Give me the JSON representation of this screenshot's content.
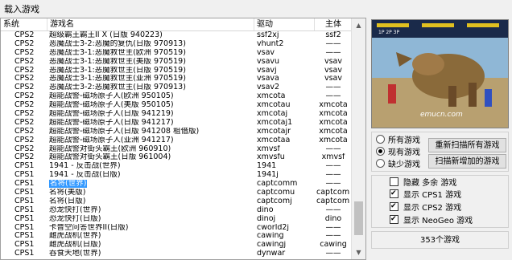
{
  "window": {
    "title": "载入游戏"
  },
  "columns": {
    "system": "系统",
    "name": "游戏名",
    "driver": "驱动",
    "host": "主体"
  },
  "rows": [
    {
      "system": "CPS2",
      "name": "超级霸王霸王II X (日版 940223)",
      "driver": "ssf2xj",
      "host": "ssf2"
    },
    {
      "system": "CPS2",
      "name": "恶魔战士3-2:恶魔的复仇(日版 970913)",
      "driver": "vhunt2",
      "host": "——"
    },
    {
      "system": "CPS2",
      "name": "恶魔战士3-1:恶魔救世主(欧洲 970519)",
      "driver": "vsav",
      "host": "——"
    },
    {
      "system": "CPS2",
      "name": "恶魔战士3-1:恶魔救世主(美版 970519)",
      "driver": "vsavu",
      "host": "vsav"
    },
    {
      "system": "CPS2",
      "name": "恶魔战士3-1:恶魔救世主(日版 970519)",
      "driver": "vsavj",
      "host": "vsav"
    },
    {
      "system": "CPS2",
      "name": "恶魔战士3-1:恶魔救世主(亚洲 970519)",
      "driver": "vsava",
      "host": "vsav"
    },
    {
      "system": "CPS2",
      "name": "恶魔战士3-2:恶魔救世主(日版 970913)",
      "driver": "vsav2",
      "host": "——"
    },
    {
      "system": "CPS2",
      "name": "超能战警-磁场原子人(欧洲 950105)",
      "driver": "xmcota",
      "host": "——"
    },
    {
      "system": "CPS2",
      "name": "超能战警-磁场原子人(美版 950105)",
      "driver": "xmcotau",
      "host": "xmcota"
    },
    {
      "system": "CPS2",
      "name": "超能战警-磁场原子人(日版 941219)",
      "driver": "xmcotaj",
      "host": "xmcota"
    },
    {
      "system": "CPS2",
      "name": "超能战警-磁场原子人(日版 941217)",
      "driver": "xmcotaj1",
      "host": "xmcota"
    },
    {
      "system": "CPS2",
      "name": "超能战警-磁场原子人(日版 941208 租借版)",
      "driver": "xmcotajr",
      "host": "xmcota"
    },
    {
      "system": "CPS2",
      "name": "超能战警-磁场原子人(亚洲 941217)",
      "driver": "xmcotaa",
      "host": "xmcota"
    },
    {
      "system": "CPS2",
      "name": "超能战警对街头霸王(欧洲 960910)",
      "driver": "xmvsf",
      "host": "——"
    },
    {
      "system": "CPS2",
      "name": "超能战警对街头霸王(日版 961004)",
      "driver": "xmvsfu",
      "host": "xmvsf"
    },
    {
      "system": "CPS1",
      "name": "1941 - 反击战(世界)",
      "driver": "1941",
      "host": "——"
    },
    {
      "system": "CPS1",
      "name": "1941 - 反击战(日版)",
      "driver": "1941j",
      "host": "——"
    },
    {
      "system": "CPS1",
      "name": "名将(世界)",
      "driver": "captcomm",
      "host": "——",
      "selected": true
    },
    {
      "system": "CPS1",
      "name": "名将(美版)",
      "driver": "captcomu",
      "host": "captcomm"
    },
    {
      "system": "CPS1",
      "name": "名将(日版)",
      "driver": "captcomj",
      "host": "captcomm"
    },
    {
      "system": "CPS1",
      "name": "恐龙快打(世界)",
      "driver": "dino",
      "host": "——"
    },
    {
      "system": "CPS1",
      "name": "恐龙快打(日版)",
      "driver": "dinoj",
      "host": "dino"
    },
    {
      "system": "CPS1",
      "name": "卡普空问答世界II(日版)",
      "driver": "cworld2j",
      "host": "——"
    },
    {
      "system": "CPS1",
      "name": "雌虎战机(世界)",
      "driver": "cawing",
      "host": "——"
    },
    {
      "system": "CPS1",
      "name": "雌虎战机(日版)",
      "driver": "cawingj",
      "host": "cawing"
    },
    {
      "system": "CPS1",
      "name": "吞食天地(世界)",
      "driver": "dynwar",
      "host": "——"
    }
  ],
  "preview": {
    "watermark": "emucn.com",
    "hud": "1P 2P 3P"
  },
  "filter": {
    "all": "所有游戏",
    "present": "现有游戏",
    "missing": "缺少游戏",
    "selected": "present"
  },
  "buttons": {
    "rescan_all": "重新扫描所有游戏",
    "scan_new": "扫描新增加的游戏"
  },
  "options": {
    "hide_clones": "隐藏 多余 游戏",
    "show_cps1": "显示 CPS1 游戏",
    "show_cps2": "显示 CPS2 游戏",
    "show_neogeo": "显示 NeoGeo 游戏"
  },
  "status": {
    "count": "353个游戏"
  }
}
